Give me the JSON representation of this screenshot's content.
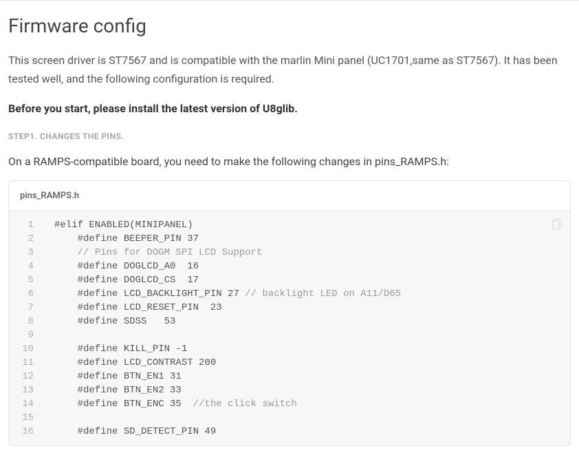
{
  "heading": "Firmware config",
  "intro": "This screen driver is ST7567 and is compatible with the marlin Mini panel (UC1701,same as ST7567). It has been tested well, and the following configuration is required.",
  "warning": "Before you start, please install the latest version of U8glib.",
  "step1": {
    "label": "STEP1. CHANGES THE PINS.",
    "desc": "On a RAMPS-compatible board, you need to make the following changes in pins_RAMPS.h:"
  },
  "code": {
    "filename": "pins_RAMPS.h",
    "lines": [
      {
        "n": "1",
        "text": "#elif ENABLED(MINIPANEL)"
      },
      {
        "n": "2",
        "text": "    #define BEEPER_PIN 37"
      },
      {
        "n": "3",
        "text": "    ",
        "comment": "// Pins for DOGM SPI LCD Support"
      },
      {
        "n": "4",
        "text": "    #define DOGLCD_A0  16"
      },
      {
        "n": "5",
        "text": "    #define DOGLCD_CS  17"
      },
      {
        "n": "6",
        "text": "    #define LCD_BACKLIGHT_PIN 27 ",
        "comment": "// backlight LED on A11/D65"
      },
      {
        "n": "7",
        "text": "    #define LCD_RESET_PIN  23"
      },
      {
        "n": "8",
        "text": "    #define SDSS   53"
      },
      {
        "n": "9",
        "text": ""
      },
      {
        "n": "10",
        "text": "    #define KILL_PIN -1"
      },
      {
        "n": "11",
        "text": "    #define LCD_CONTRAST 200"
      },
      {
        "n": "12",
        "text": "    #define BTN_EN1 31"
      },
      {
        "n": "13",
        "text": "    #define BTN_EN2 33"
      },
      {
        "n": "14",
        "text": "    #define BTN_ENC 35  ",
        "comment": "//the click switch"
      },
      {
        "n": "15",
        "text": ""
      },
      {
        "n": "16",
        "text": "    #define SD_DETECT_PIN 49"
      }
    ]
  }
}
